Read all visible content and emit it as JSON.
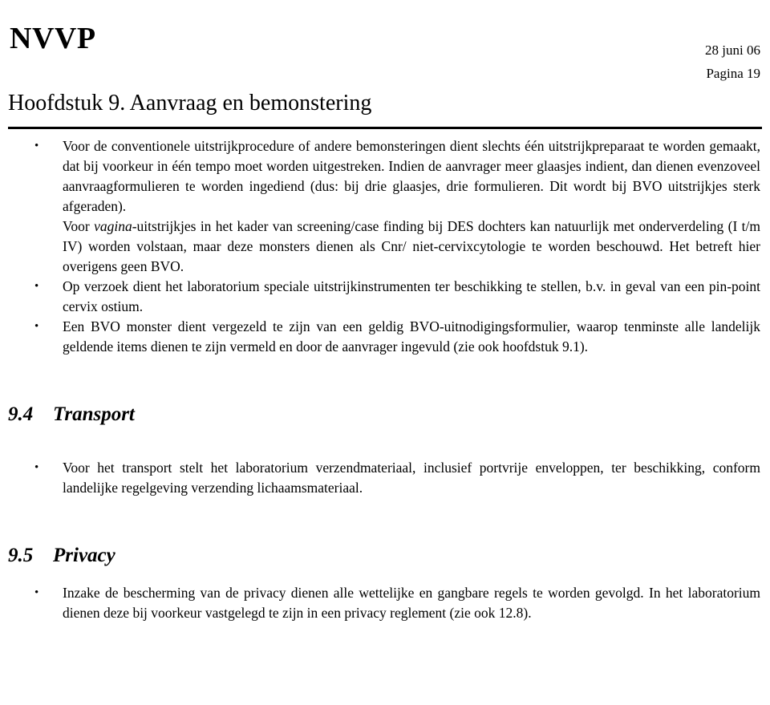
{
  "header": {
    "brand": "NVVP",
    "date": "28 juni 06",
    "page": "Pagina 19",
    "document_title": "Hoofdstuk 9. Aanvraag en bemonstering"
  },
  "body": {
    "bullets": [
      {
        "marker": true,
        "text": "Voor de conventionele uitstrijkprocedure of andere bemonsteringen dient slechts één uitstrijkpreparaat te worden gemaakt, dat bij voorkeur in één tempo moet worden uitgestreken. Indien de aanvrager meer glaasjes indient, dan dienen evenzoveel aanvraagformulieren te worden ingediend (dus: bij drie glaasjes, drie formulieren. Dit wordt bij BVO uitstrijkjes sterk afgeraden)."
      },
      {
        "marker": false,
        "text_before_italic": "Voor ",
        "italic": "vagina",
        "text_after_italic": "-uitstrijkjes in het kader van screening/case finding bij DES dochters kan natuurlijk met onderverdeling (I t/m  IV) worden volstaan, maar deze monsters dienen als Cnr/ niet-cervixcytologie te worden beschouwd. Het betreft hier overigens geen BVO."
      },
      {
        "marker": true,
        "text": "Op verzoek dient het laboratorium speciale uitstrijkinstrumenten ter beschikking te stellen, b.v. in geval van een pin-point cervix ostium."
      },
      {
        "marker": true,
        "text": "Een BVO monster dient vergezeld te zijn van een geldig BVO-uitnodigingsformulier, waarop tenminste alle landelijk geldende items dienen te zijn vermeld en door de aanvrager ingevuld (zie ook hoofdstuk 9.1)."
      }
    ],
    "sections": [
      {
        "number": "9.4",
        "title": "Transport",
        "bullets": [
          {
            "marker": true,
            "text": "Voor het transport stelt het laboratorium verzendmateriaal, inclusief portvrije enveloppen, ter beschikking, conform landelijke regelgeving verzending lichaamsmateriaal."
          }
        ]
      },
      {
        "number": "9.5",
        "title": "Privacy",
        "bullets": [
          {
            "marker": true,
            "text": "Inzake de bescherming van de privacy dienen alle wettelijke en gangbare regels te worden gevolgd. In het laboratorium dienen deze bij voorkeur vastgelegd te zijn in een privacy reglement (zie ook 12.8)."
          }
        ]
      }
    ]
  }
}
